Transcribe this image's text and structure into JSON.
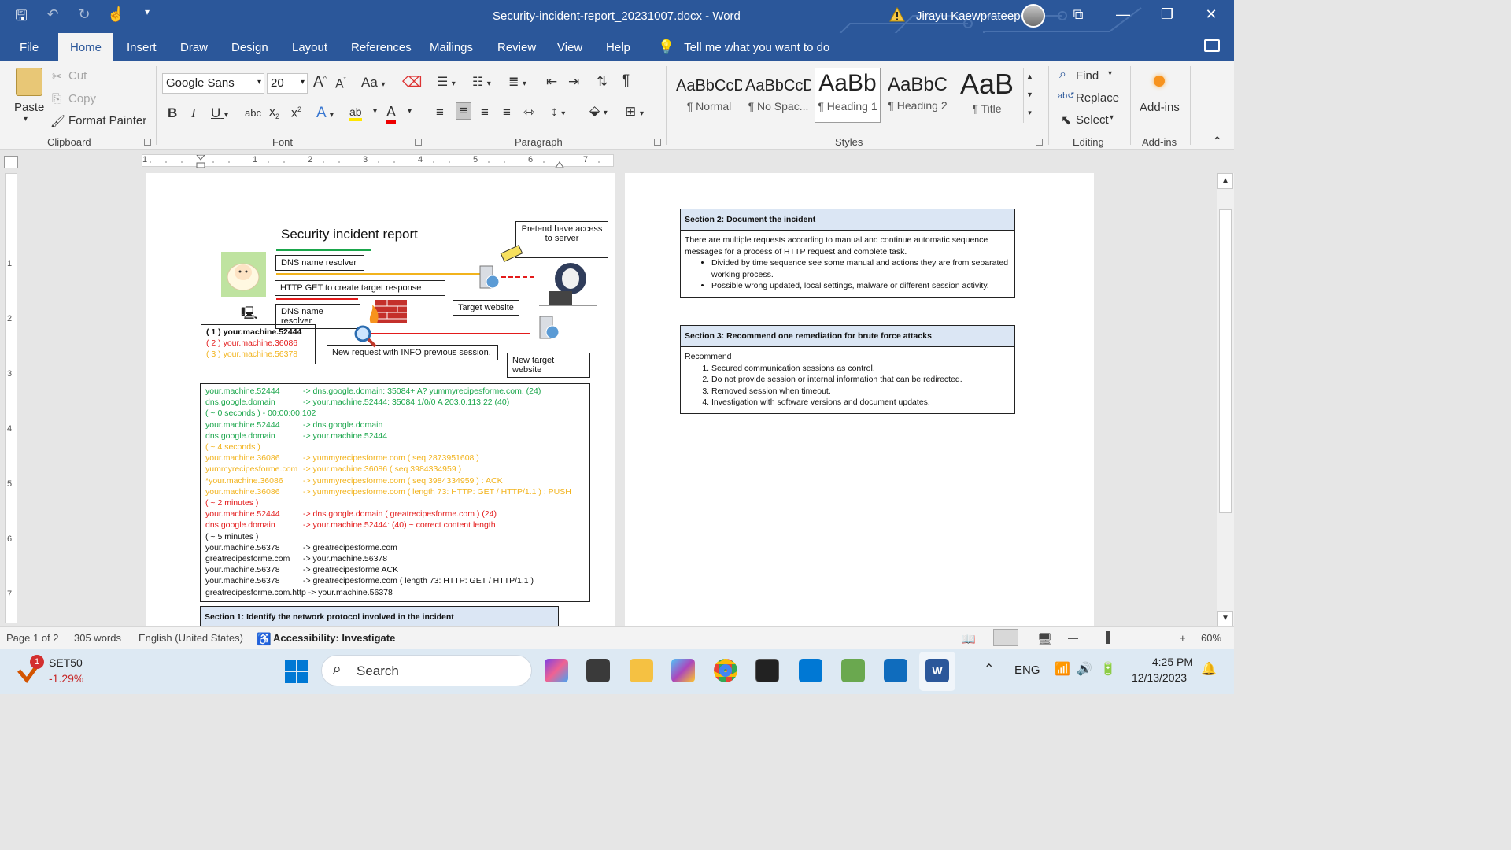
{
  "window": {
    "title": "Security-incident-report_20231007.docx  -  Word",
    "user_name": "Jirayu Kaewprateep"
  },
  "tabs": [
    "File",
    "Home",
    "Insert",
    "Draw",
    "Design",
    "Layout",
    "References",
    "Mailings",
    "Review",
    "View",
    "Help"
  ],
  "tell_me": "Tell me what you want to do",
  "ribbon": {
    "clipboard": {
      "paste": "Paste",
      "cut": "Cut",
      "copy": "Copy",
      "format_painter": "Format Painter",
      "label": "Clipboard"
    },
    "font": {
      "name": "Google Sans",
      "size": "20",
      "label": "Font",
      "case_glyph": "Aa",
      "grow_glyph": "A",
      "shrink_glyph": "A",
      "bold_glyph": "B",
      "italic_glyph": "I",
      "underline_glyph": "U",
      "strike_glyph": "abc",
      "sub_glyph": "x",
      "sub_mark": "2",
      "sup_glyph": "x",
      "sup_mark": "2",
      "highlight_glyph": "ab",
      "color_glyph": "A",
      "effects_glyph": "A"
    },
    "paragraph": {
      "label": "Paragraph",
      "pilcrow": "¶"
    },
    "styles": {
      "label": "Styles",
      "items": [
        {
          "sample": "AaBbCcD",
          "name": "¶ Normal"
        },
        {
          "sample": "AaBbCcD",
          "name": "¶ No Spac..."
        },
        {
          "sample": "AaBb",
          "name": "¶ Heading 1"
        },
        {
          "sample": "AaBbC",
          "name": "¶ Heading 2"
        },
        {
          "sample": "AaB",
          "name": "¶ Title"
        }
      ]
    },
    "editing": {
      "find": "Find",
      "replace": "Replace",
      "select": "Select",
      "label": "Editing"
    },
    "addins": {
      "button": "Add-ins",
      "label": "Add-ins"
    }
  },
  "ruler": {
    "h_numbers": [
      "1",
      "1",
      "2",
      "3",
      "4",
      "5",
      "6",
      "7"
    ],
    "v_numbers": [
      "1",
      "2",
      "3",
      "4",
      "5",
      "6",
      "7"
    ]
  },
  "page1": {
    "heading": "Security incident report",
    "boxes": {
      "dns1": "DNS name resolver",
      "http": "HTTP GET to create target response",
      "dns2": "DNS name resolver",
      "pretend": "Pretend have access to server",
      "target": "Target website",
      "new_request": "New request with INFO previous session.",
      "new_target": "New target website"
    },
    "machines": [
      {
        "text": "( 1 ) your.machine.52444",
        "color": "#111111"
      },
      {
        "text": "( 2 ) your.machine.36086",
        "color": "#e31b1b"
      },
      {
        "text": "( 3 ) your.machine.56378",
        "color": "#f2b31c"
      }
    ],
    "log": [
      {
        "l": "your.machine.52444",
        "r": "-> dns.google.domain: 35084+ A? yummyrecipesforme.com. (24)",
        "color": "#1aa64b"
      },
      {
        "l": "dns.google.domain",
        "r": "-> your.machine.52444: 35084 1/0/0 A 203.0.113.22 (40)",
        "color": "#1aa64b"
      },
      {
        "l": "( ~ 0 seconds ) - 00:00:00.102",
        "r": "",
        "color": "#1aa64b"
      },
      {
        "l": "your.machine.52444",
        "r": "-> dns.google.domain",
        "color": "#1aa64b"
      },
      {
        "l": "dns.google.domain",
        "r": "-> your.machine.52444",
        "color": "#1aa64b"
      },
      {
        "l": "( ~ 4 seconds )",
        "r": "",
        "color": "#f2b31c"
      },
      {
        "l": "your.machine.36086",
        "r": "-> yummyrecipesforme.com ( seq 2873951608 )",
        "color": "#f2b31c"
      },
      {
        "l": "yummyrecipesforme.com",
        "r": "-> your.machine.36086        ( seq 3984334959 )",
        "color": "#f2b31c"
      },
      {
        "l": "*your.machine.36086",
        "r": "-> yummyrecipesforme.com ( seq 3984334959 ) : ACK",
        "color": "#f2b31c"
      },
      {
        "l": "your.machine.36086",
        "r": "-> yummyrecipesforme.com ( length 73: HTTP: GET / HTTP/1.1 ) : PUSH",
        "color": "#f2b31c"
      },
      {
        "l": "( ~ 2 minutes )",
        "r": "",
        "color": "#e31b1b"
      },
      {
        "l": "your.machine.52444",
        "r": "-> dns.google.domain     ( greatrecipesforme.com ) (24)",
        "color": "#e31b1b"
      },
      {
        "l": "dns.google.domain",
        "r": "-> your.machine.52444:   (40) ~ correct content length",
        "color": "#e31b1b"
      },
      {
        "l": "( ~ 5 minutes )",
        "r": "",
        "color": "#111111"
      },
      {
        "l": "your.machine.56378",
        "r": "-> greatrecipesforme.com",
        "color": "#111111"
      },
      {
        "l": "greatrecipesforme.com",
        "r": "-> your.machine.56378",
        "color": "#111111"
      },
      {
        "l": "your.machine.56378",
        "r": "-> greatrecipesforme       ACK",
        "color": "#111111"
      },
      {
        "l": "your.machine.56378",
        "r": "-> greatrecipesforme.com ( length 73: HTTP: GET / HTTP/1.1 )",
        "color": "#111111"
      },
      {
        "l": "greatrecipesforme.com.http -> your.machine.56378",
        "r": "",
        "color": "#111111"
      }
    ],
    "section1": "Section 1: Identify the network protocol involved in the incident"
  },
  "page2": {
    "section2": {
      "title": "Section 2: Document the incident",
      "intro": "There are multiple requests according to manual and continue automatic sequence messages for a process of HTTP request and complete task.",
      "bullets": [
        "Divided by time sequence see some manual and actions they are from separated working process.",
        "Possible wrong updated, local settings, malware or different session activity."
      ]
    },
    "section3": {
      "title": "Section 3: Recommend one remediation for brute force attacks",
      "intro": "Recommend",
      "items": [
        "Secured communication sessions as control.",
        "Do not provide session or internal information that can be redirected.",
        "Removed session when timeout.",
        "Investigation with software versions and document updates."
      ]
    }
  },
  "status": {
    "page": "Page 1 of 2",
    "words": "305 words",
    "language": "English (United States)",
    "accessibility": "Accessibility: Investigate",
    "zoom": "60%"
  },
  "taskbar": {
    "stock_name": "SET50",
    "stock_change": "-1.29%",
    "badge": "1",
    "search": "Search",
    "lang": "ENG",
    "time": "4:25 PM",
    "date": "12/13/2023"
  }
}
